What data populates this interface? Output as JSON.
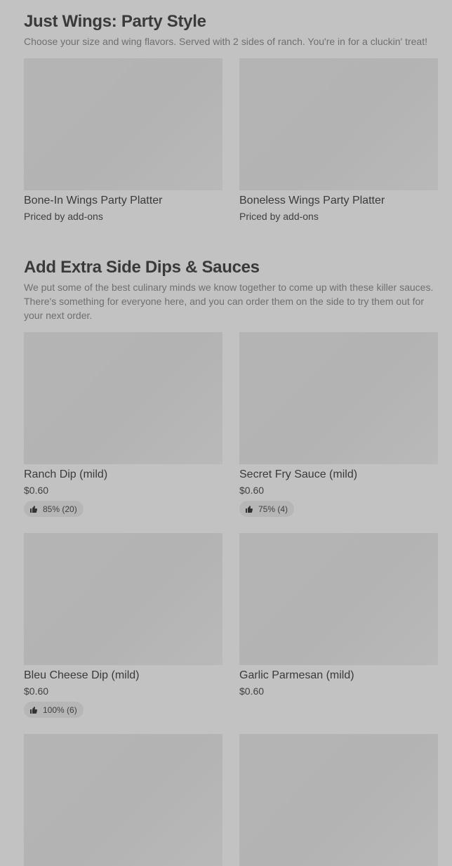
{
  "sections": [
    {
      "title": "Just Wings: Party Style",
      "description": "Choose your size and wing flavors. Served with 2 sides of ranch. You're in for a cluckin' treat!",
      "items": [
        {
          "name": "Bone-In Wings Party Platter",
          "price": "Priced by add-ons"
        },
        {
          "name": "Boneless Wings Party Platter",
          "price": "Priced by add-ons"
        }
      ]
    },
    {
      "title": "Add Extra Side Dips & Sauces",
      "description": "We put some of the best culinary minds we know together to come up with these killer sauces. There's something for everyone here, and you can order them on the side to try them out for your next order.",
      "items": [
        {
          "name": "Ranch Dip (mild)",
          "price": "$0.60",
          "rating": "85% (20)",
          "rating_icon": "thumbs-up-icon"
        },
        {
          "name": "Secret Fry Sauce (mild)",
          "price": "$0.60",
          "rating": "75% (4)",
          "rating_icon": "thumbs-up-icon"
        },
        {
          "name": "Bleu Cheese Dip (mild)",
          "price": "$0.60",
          "rating": "100% (6)",
          "rating_icon": "thumbs-up-icon"
        },
        {
          "name": "Garlic Parmesan (mild)",
          "price": "$0.60"
        }
      ]
    }
  ]
}
